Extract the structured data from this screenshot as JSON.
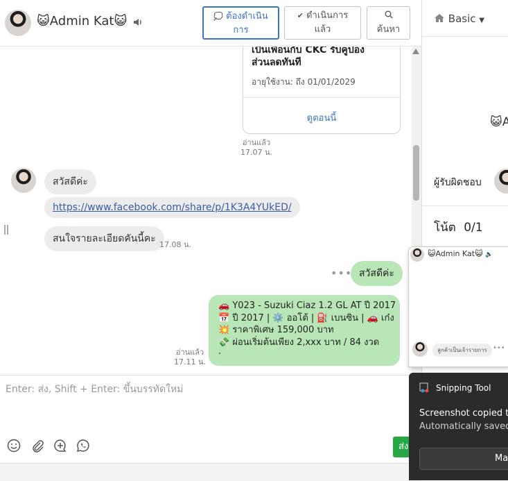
{
  "header": {
    "name": "Admin Kat",
    "name_prefix_emoji": "😺",
    "name_suffix_emoji": "😺",
    "buttons": [
      {
        "label_line1": "ต้องดำเนิน",
        "label_line2": "การ"
      },
      {
        "label_line1": "ดำเนินการ",
        "label_line2": "แล้ว"
      },
      {
        "label_line1": "ค้นหา"
      }
    ]
  },
  "card": {
    "title_line1": "เป็นเพื่อนกับ CKC รับคูปอง",
    "title_line2": "ส่วนลดทันที",
    "expiry": "อายุใช้งาน: ถึง 01/01/2029",
    "link_label": "ดูตอนนี้"
  },
  "messages": {
    "read_label": "อ่านแล้ว",
    "card_time": "17.07 น.",
    "in_greeting": "สวัสดีค่ะ",
    "in_link": "https://www.facebook.com/share/p/1K3A4YUkED/",
    "in_question": "สนใจรายละเอียดคันนี้คะ",
    "in_time": "17.08 น.",
    "out_greeting": "สวัสดีค่ะ",
    "out_time": "17.11 น.",
    "out_car_lines": [
      "🚗 Y023 - Suzuki Ciaz 1.2 GL AT ปี 2017",
      "📅 ปี 2017 | ⚙️ ออโต้ | ⛽ เบนซิน | 🚗 เก๋ง",
      "💥 ราคาพิเศษ 159,000 บาท",
      "💸 ผ่อนเริ่มต้นเพียง 2,xxx บาท / 84 งวด",
      "."
    ]
  },
  "input": {
    "placeholder": "Enter: ส่ง, Shift + Enter: ขึ้นบรรทัดใหม่",
    "send_label": "ส่ง"
  },
  "right_panel": {
    "basic_label": "Basic",
    "owner_label": "ผู้รับผิดชอบ",
    "note_label": "โน้ต",
    "note_count": "0/1",
    "partial_emoji": "😺A"
  },
  "popup": {
    "name": "😺Admin Kat😺",
    "chip_label": "ลูกค้าเป็นเจ้ารายการ"
  },
  "toast": {
    "app_name": "Snipping Tool",
    "line1": "Screenshot copied to",
    "line2": "Automatically saved t",
    "button_label": "Ma"
  }
}
